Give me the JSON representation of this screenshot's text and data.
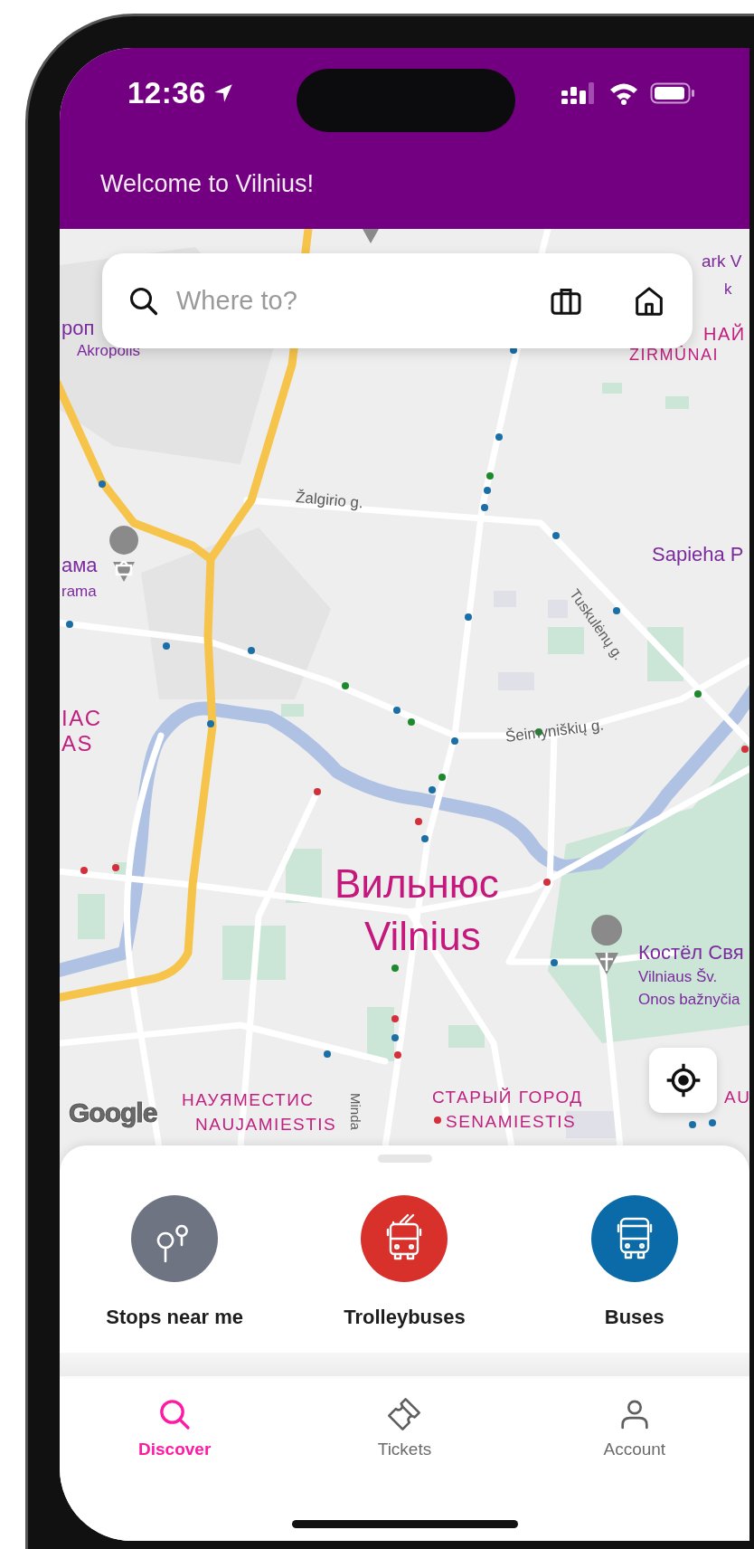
{
  "status_bar": {
    "time": "12:36"
  },
  "header": {
    "title": "Welcome to Vilnius!"
  },
  "search": {
    "placeholder": "Where to?"
  },
  "map": {
    "labels": [
      {
        "text": "ark V",
        "kind": "poi"
      },
      {
        "text": "k",
        "kind": "poi"
      },
      {
        "text": "роп",
        "kind": "poi"
      },
      {
        "text": "Akropolis",
        "kind": "poi"
      },
      {
        "text": "НАЙ",
        "kind": "district"
      },
      {
        "text": "ŽIRMŪNAI",
        "kind": "district"
      },
      {
        "text": "Žalgirio g.",
        "kind": "street"
      },
      {
        "text": "Sapieha P",
        "kind": "poi"
      },
      {
        "text": "ама",
        "kind": "poi"
      },
      {
        "text": "rama",
        "kind": "poi"
      },
      {
        "text": "Tuskulėnų g.",
        "kind": "street"
      },
      {
        "text": "IAC",
        "kind": "district"
      },
      {
        "text": "AS",
        "kind": "district"
      },
      {
        "text": "Šeimyniškių g.",
        "kind": "street"
      },
      {
        "text": "Вильнюс",
        "kind": "city"
      },
      {
        "text": "Vilnius",
        "kind": "city"
      },
      {
        "text": "Костёл Свя",
        "kind": "poi"
      },
      {
        "text": "Vilniaus Šv.",
        "kind": "poi"
      },
      {
        "text": "Onos bažnyčia",
        "kind": "poi"
      },
      {
        "text": "НАУЯМЕСТИС",
        "kind": "district"
      },
      {
        "text": "NAUJAMIESTIS",
        "kind": "district"
      },
      {
        "text": "Minda",
        "kind": "street"
      },
      {
        "text": "СТАРЫЙ ГОРОД",
        "kind": "district"
      },
      {
        "text": "SENAMIESTIS",
        "kind": "district"
      },
      {
        "text": "AU",
        "kind": "district"
      }
    ],
    "attribution": "Google"
  },
  "quick_actions": [
    {
      "label": "Stops near me",
      "kind": "stops",
      "color": "#6f7482"
    },
    {
      "label": "Trolleybuses",
      "kind": "trolleybus",
      "color": "#d8312c"
    },
    {
      "label": "Buses",
      "kind": "bus",
      "color": "#0a6ba8"
    }
  ],
  "tabs": [
    {
      "label": "Discover",
      "kind": "search",
      "selected": true
    },
    {
      "label": "Tickets",
      "kind": "ticket",
      "selected": false
    },
    {
      "label": "Account",
      "kind": "person",
      "selected": false
    }
  ]
}
